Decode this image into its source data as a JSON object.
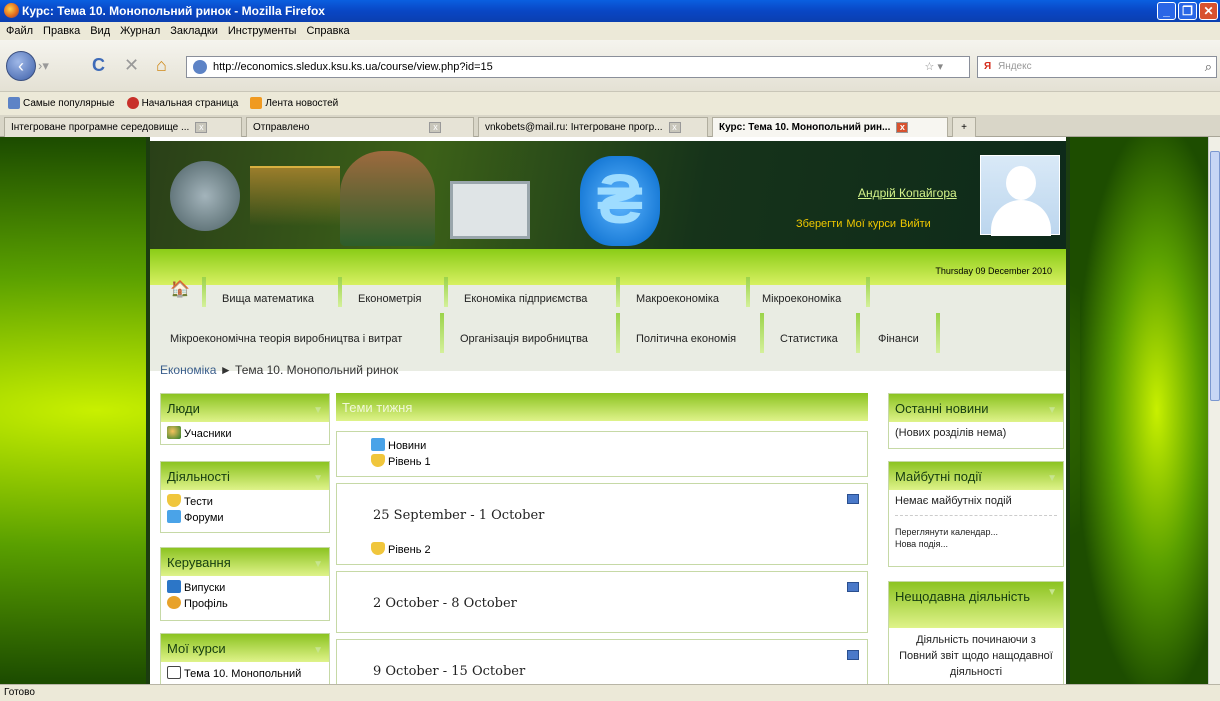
{
  "window": {
    "title": "Курс: Тема 10. Монопольний ринок - Mozilla Firefox"
  },
  "menubar": [
    "Файл",
    "Правка",
    "Вид",
    "Журнал",
    "Закладки",
    "Инструменты",
    "Справка"
  ],
  "navbar": {
    "url": "http://economics.sledux.ksu.ks.ua/course/view.php?id=15",
    "search_placeholder": "Яндекс",
    "search_engine": "Я"
  },
  "bookmarks": [
    "Самые популярные",
    "Начальная страница",
    "Лента новостей"
  ],
  "tabs": [
    {
      "label": "Інтегроване програмне середовище ...",
      "active": false
    },
    {
      "label": "Отправлено",
      "active": false
    },
    {
      "label": "vnkobets@mail.ru: Інтегроване прогр...",
      "active": false
    },
    {
      "label": "Курс: Тема 10. Монопольний рин...",
      "active": true
    }
  ],
  "status": "Готово",
  "header": {
    "user_name": "Андрій Копайгора",
    "save": "Зберегти",
    "my_courses": "Мої курси",
    "logout": "Вийти",
    "date": "Thursday 09 December 2010"
  },
  "topnav": {
    "row1": [
      "Вища математика",
      "Економетрія",
      "Економіка підприємства",
      "Макроекономіка",
      "Мікроекономіка"
    ],
    "row2": [
      "Мікроекономічна теорія виробництва і витрат",
      "Організація виробництва",
      "Політична економія",
      "Статистика",
      "Фінанси"
    ]
  },
  "breadcrumb": {
    "root": "Економіка",
    "sep": "►",
    "current": "Тема 10. Монопольний ринок"
  },
  "left": {
    "people": {
      "title": "Люди",
      "items": [
        "Учасники"
      ]
    },
    "activities": {
      "title": "Діяльності",
      "items": [
        "Тести",
        "Форуми"
      ]
    },
    "admin": {
      "title": "Керування",
      "items": [
        "Випуски",
        "Профіль"
      ]
    },
    "mycourses": {
      "title": "Мої курси",
      "items": [
        "Тема 10. Монопольний"
      ]
    }
  },
  "center": {
    "header": "Теми тижня",
    "intro": {
      "items": [
        "Новини",
        "Рівень 1"
      ]
    },
    "weeks": [
      {
        "title": "25 September - 1 October",
        "items": [
          "Рівень 2"
        ]
      },
      {
        "title": "2 October - 8 October",
        "items": []
      },
      {
        "title": "9 October - 15 October",
        "items": []
      }
    ]
  },
  "right": {
    "news": {
      "title": "Останні новини",
      "text": "(Нових розділів нема)"
    },
    "events": {
      "title": "Майбутні події",
      "text": "Немає майбутніх подій",
      "links": [
        "Переглянути календар...",
        "Нова подія..."
      ]
    },
    "recent": {
      "title": "Нещодавна діяльність",
      "text1": "Діяльність починаючи з",
      "text2": "Повний звіт щодо нащодавної діяльності"
    }
  }
}
